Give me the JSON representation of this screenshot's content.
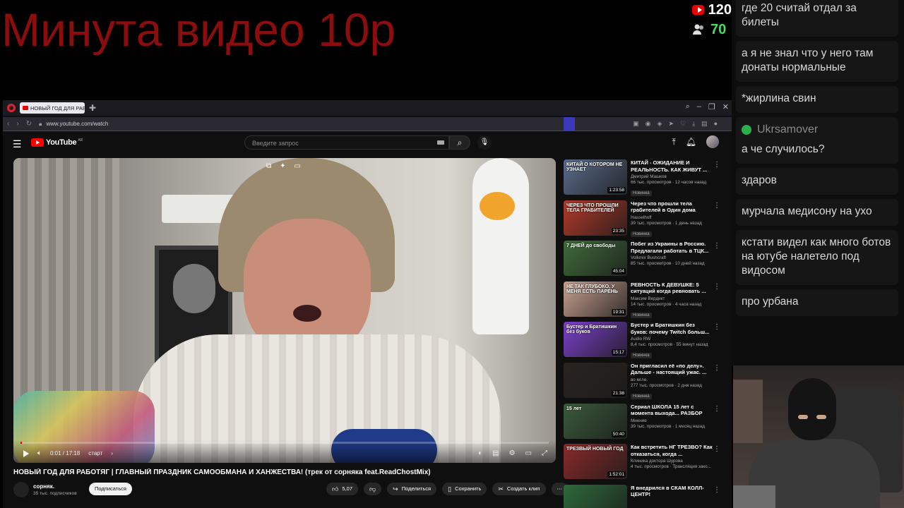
{
  "overlay": {
    "promo_text": "Минута видео 10р",
    "youtube_count": "120",
    "viewer_count": "70",
    "colors": {
      "promo": "#8b0d0d",
      "viewers": "#4cd964"
    }
  },
  "chat": {
    "messages": [
      {
        "user": "",
        "text": "где 20 считай отдал за билеты"
      },
      {
        "user": "",
        "text": "а я не знал что у него там донаты нормальные"
      },
      {
        "user": "",
        "text": "*жирлина свин"
      },
      {
        "user": "Ukrsamover",
        "text": "а че случилось?"
      },
      {
        "user": "",
        "text": "здаров"
      },
      {
        "user": "",
        "text": "мурчала медисону на ухо"
      },
      {
        "user": "",
        "text": "кстати видел как много ботов на ютубе налетело под видосом"
      },
      {
        "user": "",
        "text": "про урбана"
      }
    ]
  },
  "browser": {
    "tab_title": "НОВЫЙ ГОД ДЛЯ РАБОТЯГ",
    "url": "www.youtube.com/watch"
  },
  "youtube": {
    "logo_text": "YouTube",
    "region": "AR",
    "search_placeholder": "Введите запрос",
    "player": {
      "time": "0:01 / 17:18",
      "chapter": "старт",
      "progress": 0.001
    },
    "video": {
      "title": "НОВЫЙ ГОД ДЛЯ РАБОТЯГ | ГЛАВНЫЙ ПРАЗДНИК САМООБМАНА И ХАНЖЕСТВА! (трек от сорняка feat.ReadChostMix)",
      "channel": "сорняк.",
      "subscribers": "35 тыс. подписчиков",
      "subscribe_label": "Подписаться",
      "likes": "5,07",
      "share_label": "Поделиться",
      "save_label": "Сохранить",
      "clip_label": "Создать клип"
    },
    "recommendations": [
      {
        "title": "КИТАЙ - ОЖИДАНИЕ И РЕАЛЬНОСТЬ. КАК ЖИВУТ ...",
        "channel": "Дмитрий Машков",
        "meta": "66 тыс. просмотров · 12 часов назад",
        "badge": "Новинка",
        "duration": "1:23:58",
        "thumb_text": "КИТАЙ О КОТОРОМ НЕ УЗНАЕТ",
        "thumb_color": "#5b6b8a"
      },
      {
        "title": "Через что прошли тела грабителей в Один дома",
        "channel": "Hasselhoff",
        "meta": "39 тыс. просмотров · 1 день назад",
        "badge": "Новинка",
        "duration": "23:35",
        "thumb_text": "ЧЕРЕЗ ЧТО ПРОШЛИ ТЕЛА ГРАБИТЕЛЕЙ",
        "thumb_color": "#b23a2a"
      },
      {
        "title": "Побег из Украины в Россию. Предлагали работать в ТЦК...",
        "channel": "Volkmix Bushcraft",
        "meta": "85 тыс. просмотров · 10 дней назад",
        "badge": "",
        "duration": "45:04",
        "thumb_text": "7 ДНЕЙ до свободы",
        "thumb_color": "#3f6b3a"
      },
      {
        "title": "РЕВНОСТЬ К ДЕВУШКЕ: 5 ситуаций когда ревновать ...",
        "channel": "Максим Вердикт",
        "meta": "14 тыс. просмотров · 4 часа назад",
        "badge": "Новинка",
        "duration": "19:31",
        "thumb_text": "НЕ ТАК ГЛУБОКО, У МЕНЯ ЕСТЬ ПАРЕНЬ",
        "thumb_color": "#c9a090"
      },
      {
        "title": "Бустер и Братишкин без буков: почему Twitch больш...",
        "channel": "Audio RW",
        "meta": "8,4 тыс. просмотров · 55 минут назад",
        "badge": "Новинка",
        "duration": "15:17",
        "thumb_text": "Бустер и Братишкин без буков",
        "thumb_color": "#7b3fc9"
      },
      {
        "title": "Он пригласил её «по делу». Дальше - настоящий ужас. ...",
        "channel": "во мгле.",
        "meta": "277 тыс. просмотров · 2 дня назад",
        "badge": "Новинка",
        "duration": "21:38",
        "thumb_text": "",
        "thumb_color": "#2a2420"
      },
      {
        "title": "Сериал ШКОЛА 15 лет с момента выхода... РАЗБОР",
        "channel": "Мнение",
        "meta": "39 тыс. просмотров · 1 месяц назад",
        "badge": "",
        "duration": "50:40",
        "thumb_text": "15 лет",
        "thumb_color": "#3a5a3a"
      },
      {
        "title": "Как встретить НГ ТРЕЗВО? Как отказаться, когда ...",
        "channel": "Клиника доктора Шурова",
        "meta": "4 тыс. просмотров · Трансляция зако...",
        "badge": "",
        "duration": "1:52:01",
        "thumb_text": "ТРЕЗВЫЙ НОВЫЙ ГОД",
        "thumb_color": "#8a2a2a"
      },
      {
        "title": "Я внедрился в СКАМ КОЛЛ-ЦЕНТР!",
        "channel": "",
        "meta": "",
        "badge": "",
        "duration": "",
        "thumb_text": "",
        "thumb_color": "#2e6a3a"
      }
    ]
  }
}
